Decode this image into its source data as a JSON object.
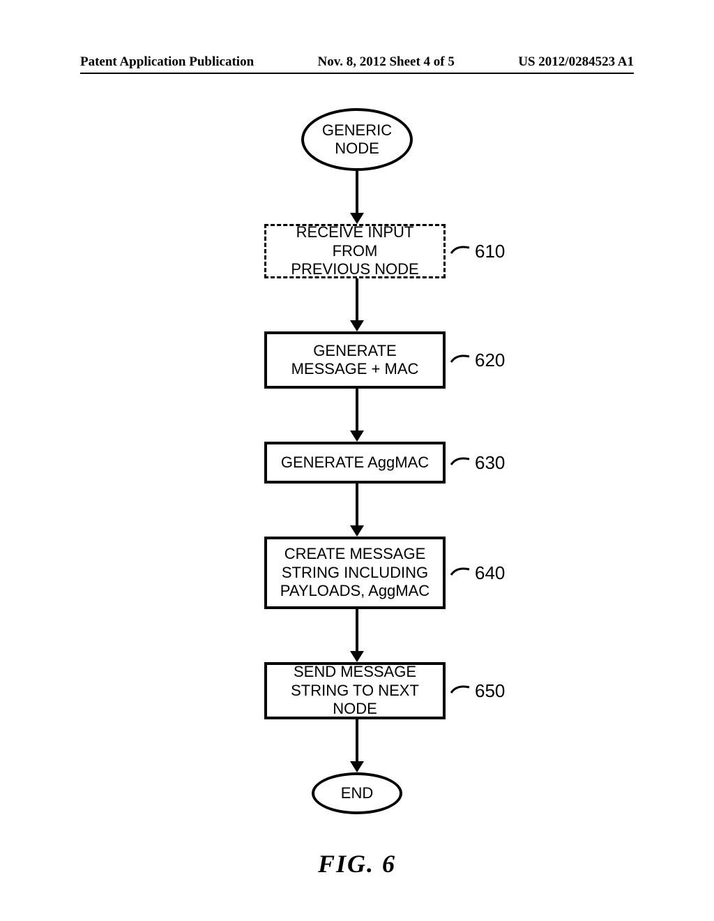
{
  "header": {
    "left": "Patent Application Publication",
    "center": "Nov. 8, 2012  Sheet 4 of 5",
    "right": "US 2012/0284523 A1"
  },
  "flowchart": {
    "start": {
      "line1": "GENERIC",
      "line2": "NODE"
    },
    "steps": [
      {
        "id": "610",
        "line1": "RECEIVE INPUT FROM",
        "line2": "PREVIOUS NODE",
        "style": "dashed"
      },
      {
        "id": "620",
        "line1": "GENERATE",
        "line2": "MESSAGE + MAC",
        "style": "solid"
      },
      {
        "id": "630",
        "line1": "GENERATE AggMAC",
        "line2": "",
        "style": "solid"
      },
      {
        "id": "640",
        "line1": "CREATE MESSAGE",
        "line2": "STRING INCLUDING",
        "line3": "PAYLOADS, AggMAC",
        "style": "solid"
      },
      {
        "id": "650",
        "line1": "SEND MESSAGE",
        "line2": "STRING TO NEXT NODE",
        "style": "solid"
      }
    ],
    "end": "END"
  },
  "figure_label": "FIG.   6"
}
